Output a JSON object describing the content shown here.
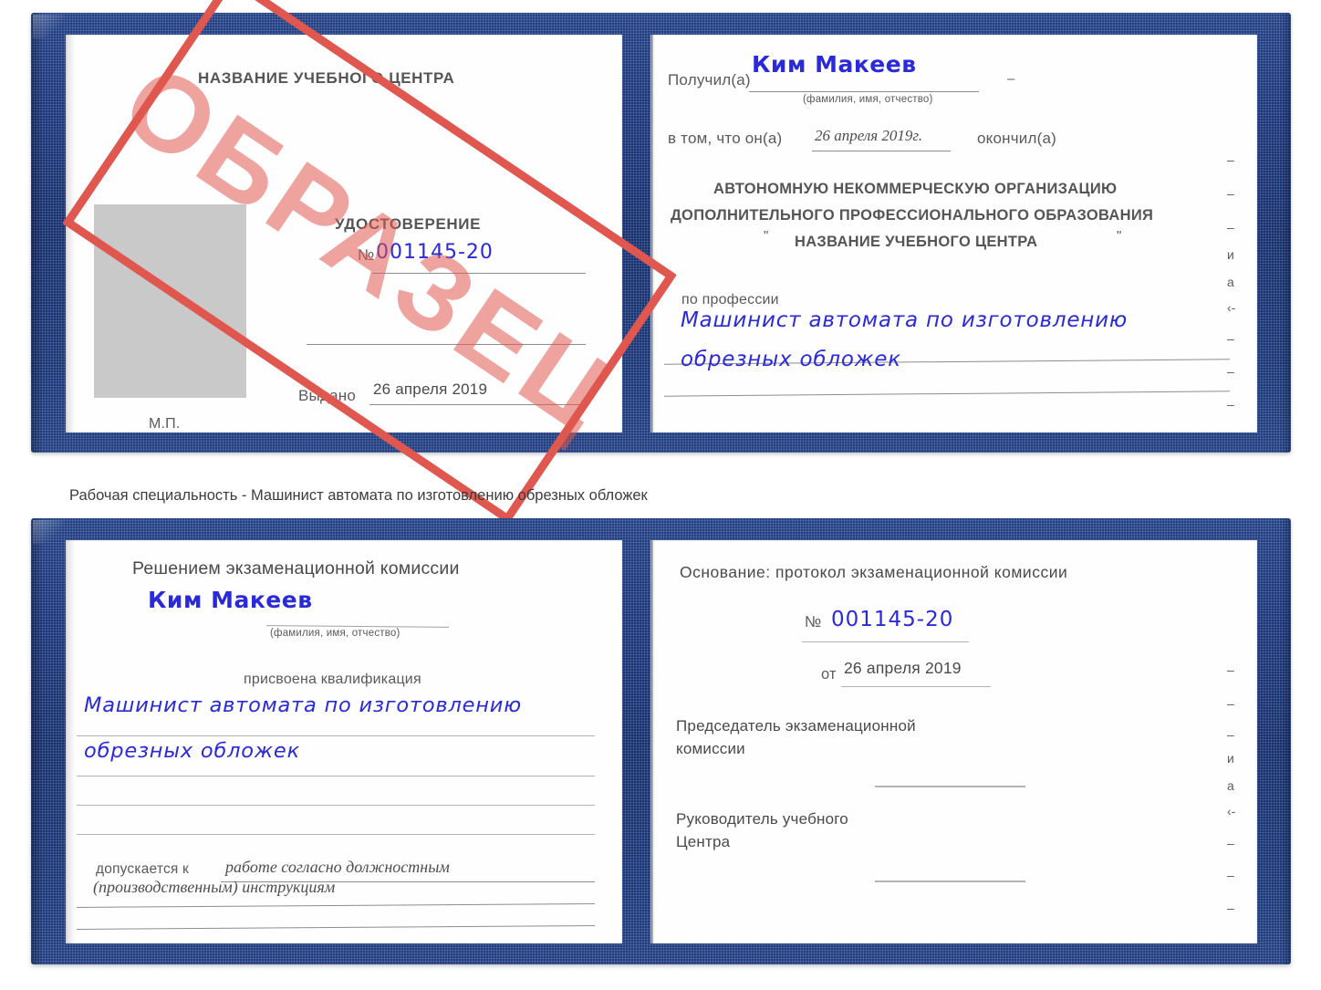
{
  "caption": "Рабочая специальность - Машинист автомата по изготовлению обрезных обложек",
  "watermark": {
    "text": "ОБРАЗЕЦ",
    "color": "#e0574f"
  },
  "colors": {
    "cover_blue": "#1e3a80",
    "handwriting_blue": "#2a2ad8",
    "paper_white": "#fefefe",
    "photo_placeholder": "#c9c9c9",
    "rule_grey": "#8d8d8d"
  },
  "doc_top": {
    "left_page": {
      "center_name": "НАЗВАНИЕ УЧЕБНОГО ЦЕНТРА",
      "title": "УДОСТОВЕРЕНИЕ",
      "number_label": "№",
      "number_value": "001145-20",
      "issued_label": "Выдано",
      "issued_value": "26 апреля 2019",
      "seal_label": "М.П.",
      "photo_placeholder": "photo-placeholder"
    },
    "right_page": {
      "received_label": "Получил(а)",
      "received_value": "Ким Макеев",
      "received_hint": "(фамилия, имя, отчество)",
      "that_label": "в том, что он(а)",
      "that_value": "26 апреля 2019г.",
      "finished_label": "окончил(а)",
      "org_line1": "АВТОНОМНУЮ НЕКОММЕРЧЕСКУЮ ОРГАНИЗАЦИЮ",
      "org_line2": "ДОПОЛНИТЕЛЬНОГО ПРОФЕССИОНАЛЬНОГО ОБРАЗОВАНИЯ",
      "org_quote_open": "\"",
      "org_line3": "НАЗВАНИЕ УЧЕБНОГО ЦЕНТРА",
      "org_quote_close": "\"",
      "profession_label": "по профессии",
      "profession_line1": "Машинист автомата по изготовлению",
      "profession_line2": "обрезных обложек"
    },
    "edge_marks": [
      "–",
      "–",
      "–",
      "и",
      "а",
      "‹-",
      "–",
      "–",
      "–"
    ]
  },
  "doc_bottom": {
    "left_page": {
      "decision_title": "Решением экзаменационной комиссии",
      "name_value": "Ким Макеев",
      "name_hint": "(фамилия, имя, отчество)",
      "qualification_label": "присвоена квалификация",
      "qualification_line1": "Машинист автомата по изготовлению",
      "qualification_line2": "обрезных обложек",
      "allowed_label": "допускается к",
      "allowed_value_line1": "работе согласно должностным",
      "allowed_value_line2": "(производственным) инструкциям"
    },
    "right_page": {
      "basis_label": "Основание: протокол экзаменационной комиссии",
      "number_label": "№",
      "number_value": "001145-20",
      "date_label": "от",
      "date_value": "26 апреля 2019",
      "chairman_line1": "Председатель экзаменационной",
      "chairman_line2": "комиссии",
      "head_line1": "Руководитель учебного",
      "head_line2": "Центра"
    },
    "edge_marks": [
      "–",
      "–",
      "–",
      "и",
      "а",
      "‹-",
      "–",
      "–",
      "–"
    ]
  }
}
